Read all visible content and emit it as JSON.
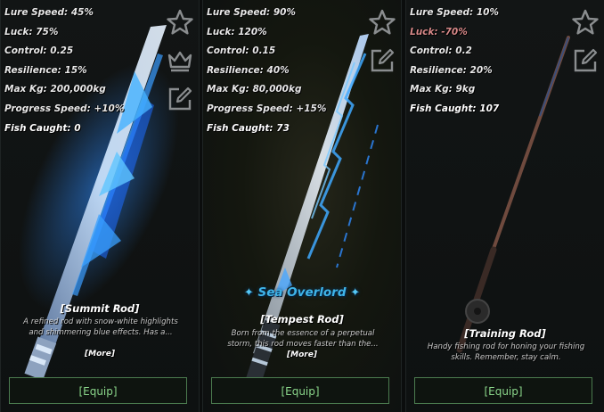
{
  "cards": [
    {
      "stats": {
        "lure_speed": "Lure Speed: 45%",
        "luck": "Luck: 75%",
        "control": "Control: 0.25",
        "resilience": "Resilience: 15%",
        "max_kg": "Max Kg: 200,000kg",
        "progress_speed": "Progress Speed: +10%",
        "fish_caught": "Fish Caught: 0"
      },
      "name": "[Summit Rod]",
      "description": "A refined rod with snow-white highlights and shimmering blue effects. Has a...",
      "more_label": "[More]",
      "equip_label": "[Equip]",
      "icons": [
        "star-icon",
        "crown-icon",
        "edit-icon"
      ]
    },
    {
      "stats": {
        "lure_speed": "Lure Speed: 90%",
        "luck": "Luck: 120%",
        "control": "Control: 0.15",
        "resilience": "Resilience: 40%",
        "max_kg": "Max Kg: 80,000kg",
        "progress_speed": "Progress Speed: +15%",
        "fish_caught": "Fish Caught: 73"
      },
      "badge": "Sea Overlord",
      "badge_color": "#3fb4e8",
      "name": "[Tempest Rod]",
      "description": "Born from the essence of a perpetual storm, this rod moves faster than the...",
      "more_label": "[More]",
      "equip_label": "[Equip]",
      "icons": [
        "star-icon",
        "edit-icon"
      ]
    },
    {
      "stats": {
        "lure_speed": "Lure Speed: 10%",
        "luck": "Luck: -70%",
        "control": "Control: 0.2",
        "resilience": "Resilience: 20%",
        "max_kg": "Max Kg: 9kg",
        "fish_caught": "Fish Caught: 107"
      },
      "negative_color": "#d98a8a",
      "name": "[Training Rod]",
      "description": "Handy fishing rod for honing your fishing skills. Remember, stay calm.",
      "equip_label": "[Equip]",
      "icons": [
        "star-icon",
        "edit-icon"
      ]
    }
  ],
  "colors": {
    "equip_border": "#4b7b4f",
    "equip_text": "#8ad68a",
    "glow_blue": "#2f8cff"
  }
}
